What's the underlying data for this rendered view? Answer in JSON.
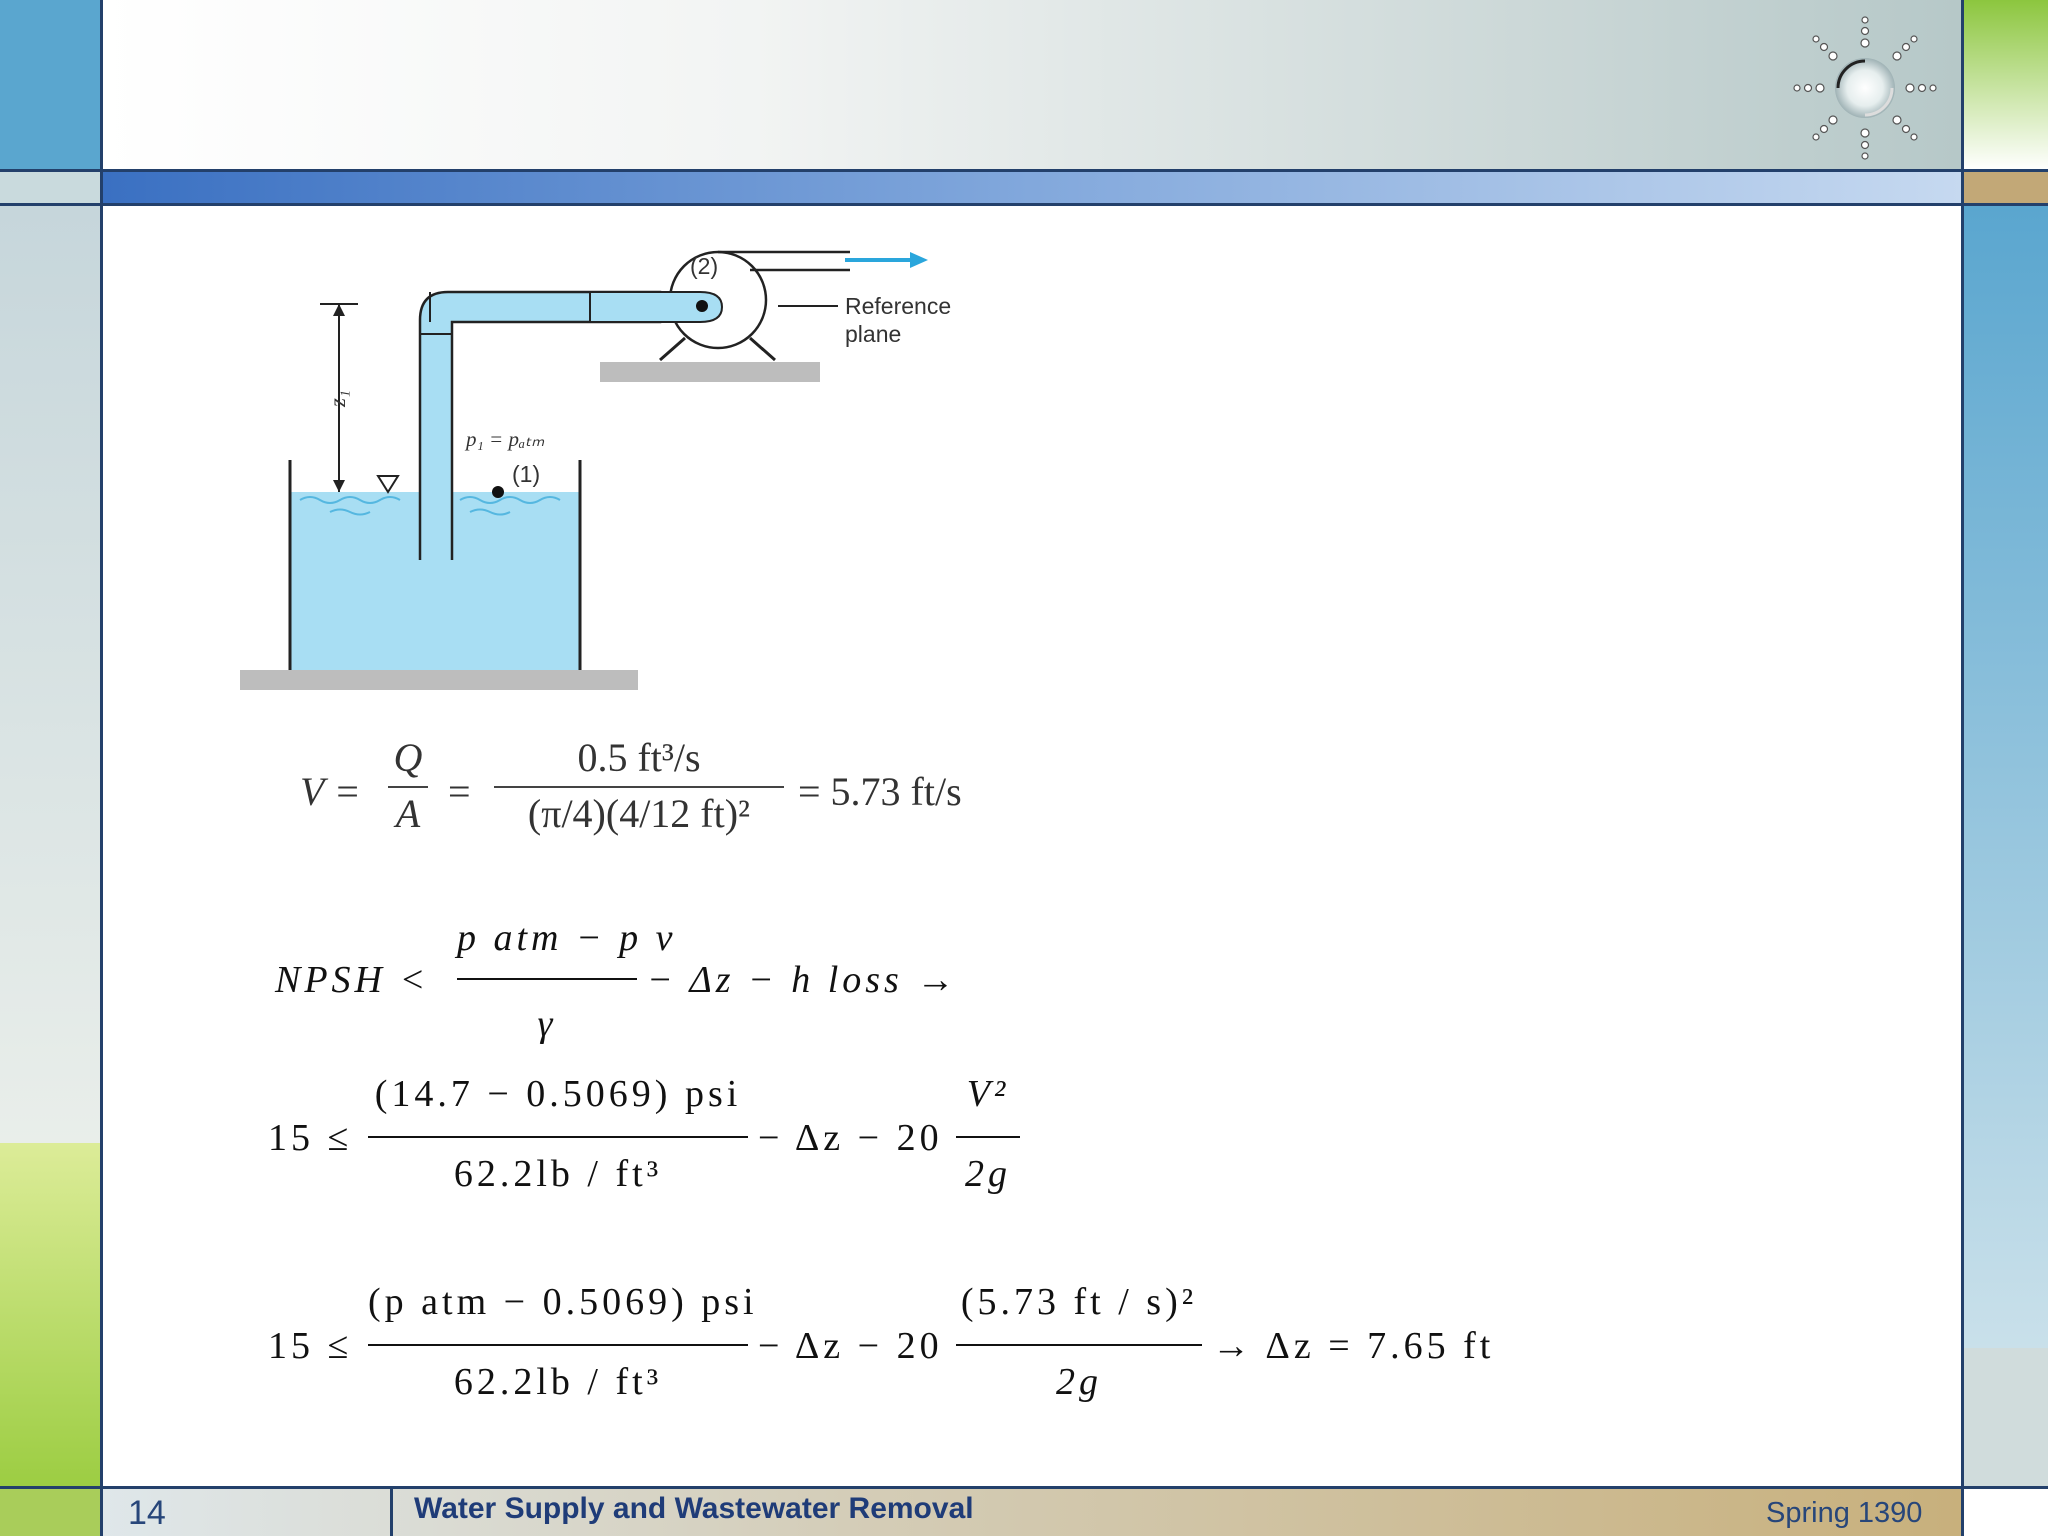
{
  "diagram": {
    "point2_label": "(2)",
    "reference_label_line1": "Reference",
    "reference_label_line2": "plane",
    "z1_label": "z₁",
    "p1_label": "p₁ = pₐₜₘ",
    "point1_label": "(1)"
  },
  "velocity_equation": {
    "lhs": "V =",
    "q_over_a_num": "Q",
    "q_over_a_den": "A",
    "eq_sign": "=",
    "num": "0.5 ft³/s",
    "den": "(π/4)(4/12 ft)²",
    "result": "= 5.73 ft/s"
  },
  "npsh_equation": {
    "lhs": "NPSH <",
    "num": "p atm − p v",
    "den": "γ",
    "rest": "− Δz − h loss →"
  },
  "equation_2": {
    "lhs": "15 ≤",
    "num": "(14.7 − 0.5069) psi",
    "den": "62.2lb / ft³",
    "middle": "− Δz − 20",
    "v_num": "V²",
    "v_den": "2g"
  },
  "equation_3": {
    "lhs": "15 ≤",
    "num": "(p atm − 0.5069) psi",
    "den": "62.2lb / ft³",
    "middle": "− Δz − 20",
    "v_num": "(5.73 ft / s)²",
    "v_den": "2g",
    "result": "→ Δz = 7.65 ft"
  },
  "footer": {
    "page_number": "14",
    "course_title": "Water Supply and Wastewater Removal",
    "term": "Spring 1390"
  }
}
